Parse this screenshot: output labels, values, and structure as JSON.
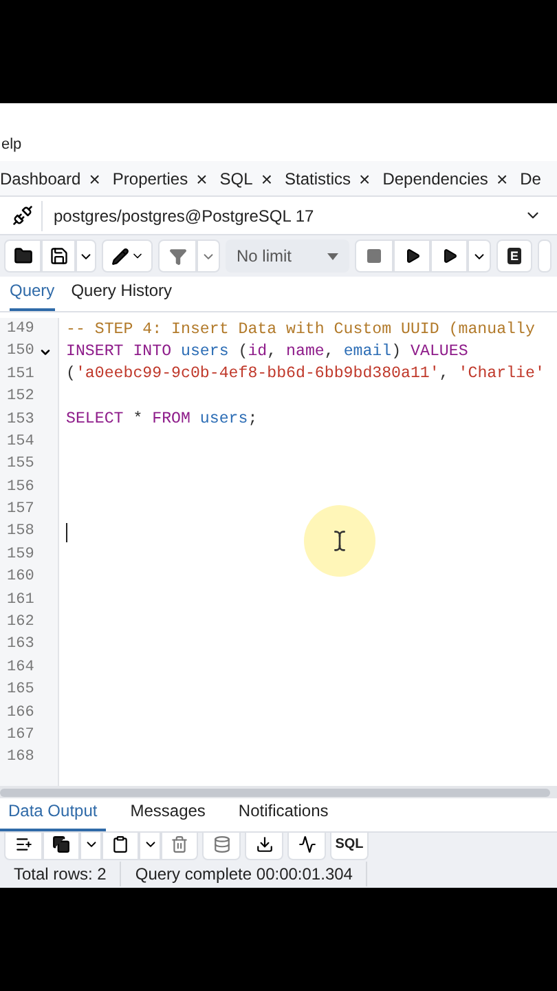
{
  "menu": {
    "item": "elp"
  },
  "panel_tabs": [
    {
      "label": "Dashboard",
      "close": "×"
    },
    {
      "label": "Properties",
      "close": "×"
    },
    {
      "label": "SQL",
      "close": "×"
    },
    {
      "label": "Statistics",
      "close": "×"
    },
    {
      "label": "Dependencies",
      "close": "×"
    },
    {
      "label": "De"
    }
  ],
  "connection": {
    "value": "postgres/postgres@PostgreSQL 17"
  },
  "toolbar": {
    "limit": "No limit",
    "explain_key": "E"
  },
  "query_tabs": [
    {
      "label": "Query",
      "selected": true
    },
    {
      "label": "Query History",
      "selected": false
    }
  ],
  "editor": {
    "lines": [
      {
        "number": "149",
        "foldable": false,
        "caret": false,
        "tokens": [
          {
            "kind": "comment",
            "text": "-- STEP 4: Insert Data with Custom UUID (manually"
          }
        ]
      },
      {
        "number": "150",
        "foldable": true,
        "caret": false,
        "tokens": [
          {
            "kind": "keyword",
            "text": "INSERT INTO"
          },
          {
            "kind": "ident",
            "text": " users"
          },
          {
            "kind": "plain",
            "text": " ("
          },
          {
            "kind": "keyword",
            "text": "id"
          },
          {
            "kind": "plain",
            "text": ", "
          },
          {
            "kind": "keyword",
            "text": "name"
          },
          {
            "kind": "plain",
            "text": ", "
          },
          {
            "kind": "ident",
            "text": "email"
          },
          {
            "kind": "plain",
            "text": ") "
          },
          {
            "kind": "keyword",
            "text": "VALUES"
          }
        ]
      },
      {
        "number": "151",
        "foldable": false,
        "caret": false,
        "tokens": [
          {
            "kind": "plain",
            "text": "("
          },
          {
            "kind": "string",
            "text": "'a0eebc99-9c0b-4ef8-bb6d-6bb9bd380a11'"
          },
          {
            "kind": "plain",
            "text": ", "
          },
          {
            "kind": "string",
            "text": "'Charlie'"
          }
        ]
      },
      {
        "number": "152",
        "foldable": false,
        "caret": false
      },
      {
        "number": "153",
        "foldable": false,
        "caret": false,
        "tokens": [
          {
            "kind": "keyword",
            "text": "SELECT"
          },
          {
            "kind": "plain",
            "text": " * "
          },
          {
            "kind": "keyword",
            "text": "FROM"
          },
          {
            "kind": "ident",
            "text": " users"
          },
          {
            "kind": "plain",
            "text": ";"
          }
        ]
      },
      {
        "number": "154",
        "foldable": false,
        "caret": false
      },
      {
        "number": "155",
        "foldable": false,
        "caret": false
      },
      {
        "number": "156",
        "foldable": false,
        "caret": false
      },
      {
        "number": "157",
        "foldable": false,
        "caret": false
      },
      {
        "number": "158",
        "foldable": false,
        "caret": true
      },
      {
        "number": "159",
        "foldable": false,
        "caret": false
      },
      {
        "number": "160",
        "foldable": false,
        "caret": false
      },
      {
        "number": "161",
        "foldable": false,
        "caret": false
      },
      {
        "number": "162",
        "foldable": false,
        "caret": false
      },
      {
        "number": "163",
        "foldable": false,
        "caret": false
      },
      {
        "number": "164",
        "foldable": false,
        "caret": false
      },
      {
        "number": "165",
        "foldable": false,
        "caret": false
      },
      {
        "number": "166",
        "foldable": false,
        "caret": false
      },
      {
        "number": "167",
        "foldable": false,
        "caret": false
      },
      {
        "number": "168",
        "foldable": false,
        "caret": false
      }
    ]
  },
  "output_tabs": [
    {
      "label": "Data Output",
      "selected": true
    },
    {
      "label": "Messages",
      "selected": false
    },
    {
      "label": "Notifications",
      "selected": false
    }
  ],
  "output_toolbar": {
    "sql_label": "SQL"
  },
  "status_bar": {
    "rows": "Total rows: 2",
    "message": "Query complete 00:00:01.304"
  }
}
